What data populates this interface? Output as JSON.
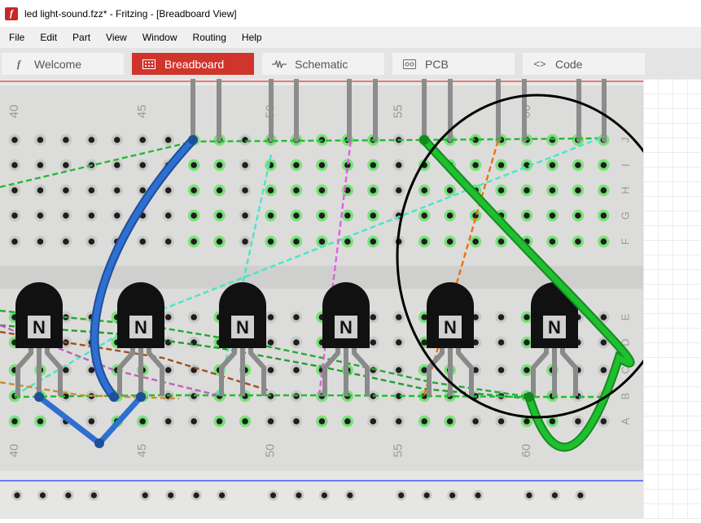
{
  "window": {
    "title": "led light-sound.fzz* - Fritzing - [Breadboard View]",
    "app_icon": "fritzing-f-icon"
  },
  "menu": [
    "File",
    "Edit",
    "Part",
    "View",
    "Window",
    "Routing",
    "Help"
  ],
  "tabs": [
    {
      "label": "Welcome",
      "icon": "fritzing-f-icon",
      "active": false
    },
    {
      "label": "Breadboard",
      "icon": "breadboard-icon",
      "active": true
    },
    {
      "label": "Schematic",
      "icon": "resistor-wave-icon",
      "active": false
    },
    {
      "label": "PCB",
      "icon": "pcb-icon",
      "active": false
    },
    {
      "label": "Code",
      "icon": "code-brackets-icon",
      "active": false
    }
  ],
  "breadboard": {
    "column_numbers_top": [
      "40",
      "45",
      "50",
      "55",
      "60"
    ],
    "column_numbers_bottom": [
      "40",
      "45",
      "50",
      "55",
      "60"
    ],
    "row_letters": [
      "J",
      "I",
      "H",
      "G",
      "F",
      "E",
      "D",
      "C",
      "B",
      "A"
    ],
    "transistor_count": 6,
    "transistor_label": "N",
    "colors": {
      "board": "#dcdcda",
      "hole": "#1e1e1e",
      "connected_hole": "#7be07b",
      "power_rail_red": "#e53935",
      "power_rail_blue": "#1e3cff",
      "blue_wire": "#2f6fd0",
      "green_wire": "#1fbf2f",
      "highlight_ellipse": "#000000"
    }
  }
}
